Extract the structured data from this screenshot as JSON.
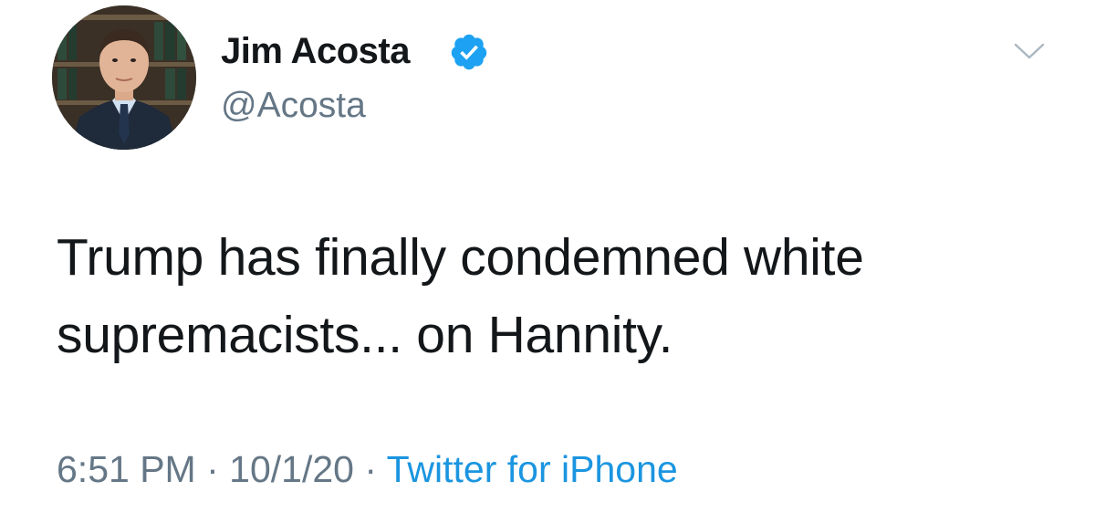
{
  "tweet": {
    "display_name": "Jim Acosta",
    "handle": "@Acosta",
    "verified": true,
    "text_line_1": "Trump has finally condemned white",
    "text_line_2": "supremacists... on Hannity.",
    "time": "6:51 PM",
    "separator_1": " · ",
    "date": "10/1/20",
    "separator_2": " · ",
    "source": "Twitter for iPhone"
  },
  "colors": {
    "text_primary": "#14171a",
    "text_secondary": "#657786",
    "link_blue": "#1b95e0",
    "verified_blue": "#1da1f2",
    "background": "#ffffff"
  },
  "icons": {
    "verified": "verified-badge-icon",
    "menu": "chevron-down-icon"
  }
}
